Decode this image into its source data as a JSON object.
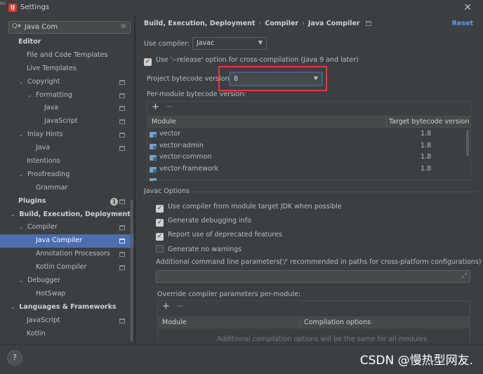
{
  "window": {
    "title": "Settings",
    "close_glyph": "✕",
    "edge_glyph": "ec",
    "app_icon_letter": "IJ"
  },
  "sidebar": {
    "search_value": "Java Com",
    "search_icon": "Q▾",
    "clear_icon": "⊗",
    "items": [
      {
        "label": "Editor"
      },
      {
        "label": "File and Code Templates"
      },
      {
        "label": "Live Templates"
      },
      {
        "label": "Copyright"
      },
      {
        "label": "Formatting"
      },
      {
        "label": "Java"
      },
      {
        "label": "JavaScript"
      },
      {
        "label": "Inlay Hints"
      },
      {
        "label": "Java"
      },
      {
        "label": "Intentions"
      },
      {
        "label": "Proofreading"
      },
      {
        "label": "Grammar"
      },
      {
        "label": "Plugins",
        "badge": "1"
      },
      {
        "label": "Build, Execution, Deployment"
      },
      {
        "label": "Compiler"
      },
      {
        "label": "Java Compiler"
      },
      {
        "label": "Annotation Processors"
      },
      {
        "label": "Kotlin Compiler"
      },
      {
        "label": "Debugger"
      },
      {
        "label": "HotSwap"
      },
      {
        "label": "Languages & Frameworks"
      },
      {
        "label": "JavaScript"
      },
      {
        "label": "Kotlin"
      }
    ]
  },
  "breadcrumb": [
    "Build, Execution, Deployment",
    "Compiler",
    "Java Compiler"
  ],
  "breadcrumb_sep": "›",
  "reset_label": "Reset",
  "use_compiler": {
    "label": "Use compiler:",
    "value": "Javac"
  },
  "release_option": {
    "label": "Use '--release' option for cross-compilation (Java 9 and later)",
    "checked": true
  },
  "bytecode_version": {
    "label": "Project bytecode version:",
    "value": "8"
  },
  "per_module": {
    "label": "Per-module bytecode version:",
    "add": "+",
    "remove": "−",
    "columns": [
      "Module",
      "Target bytecode version"
    ],
    "rows": [
      {
        "module": "vector",
        "version": "1.8"
      },
      {
        "module": "vector-admin",
        "version": "1.8"
      },
      {
        "module": "vector-common",
        "version": "1.8"
      },
      {
        "module": "vector-framework",
        "version": "1.8"
      }
    ]
  },
  "javac": {
    "title": "Javac Options",
    "options": [
      {
        "label": "Use compiler from module target JDK when possible",
        "checked": true
      },
      {
        "label": "Generate debugging info",
        "checked": true
      },
      {
        "label": "Report use of deprecated features",
        "checked": true
      },
      {
        "label": "Generate no warnings",
        "checked": false
      }
    ],
    "additional_label": "Additional command line parameters:",
    "additional_hint": "('/' recommended in paths for cross-platform configurations)",
    "expand_icon": "⤢",
    "override_label": "Override compiler parameters per-module:",
    "override_add": "+",
    "override_remove": "−",
    "override_columns": [
      "Module",
      "Compilation options"
    ],
    "override_empty": "Additional compilation options will be the same for all modules"
  },
  "footer": {
    "help": "?",
    "watermark": "CSDN @慢热型网友."
  },
  "icons": {
    "arrow_right": "›",
    "arrow_down": "⌄",
    "check": "✓",
    "combo_arrow": "▼"
  }
}
